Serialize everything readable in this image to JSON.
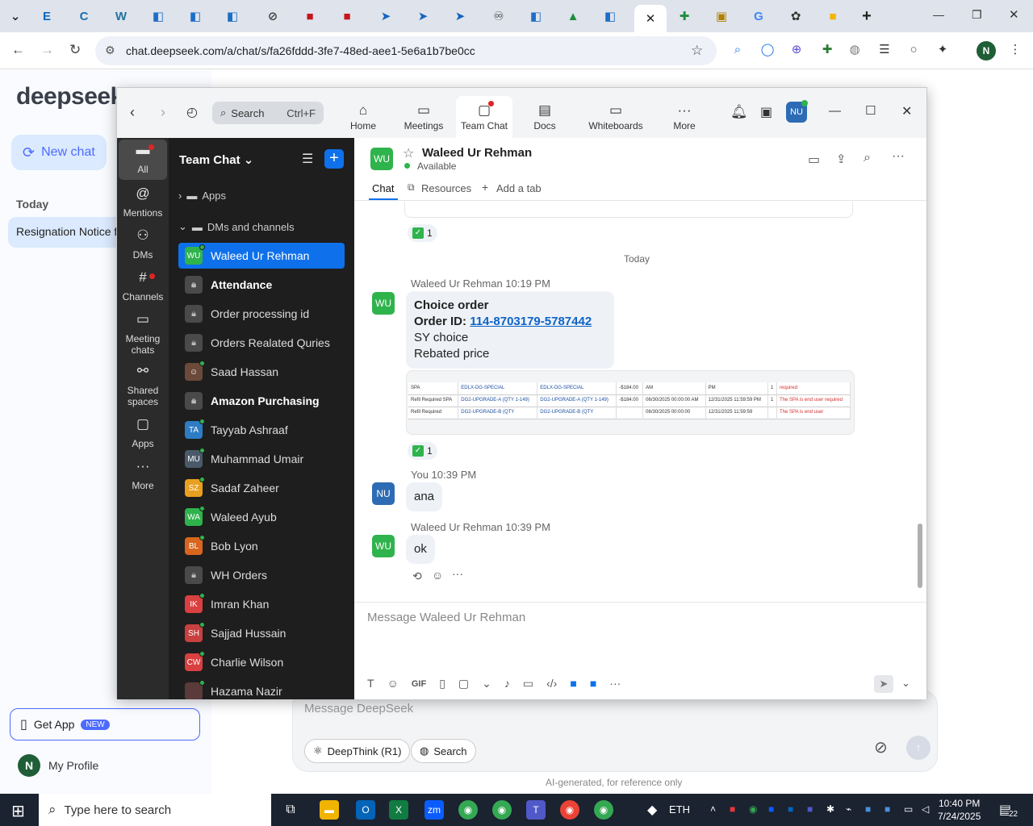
{
  "browser": {
    "url": "chat.deepseek.com/a/chat/s/fa26fddd-3fe7-48ed-aee1-5e6a1b7be0cc",
    "close_tab": "✕",
    "new_tab": "+",
    "profile_initial": "N"
  },
  "deepseek": {
    "logo": "deepseek",
    "new_chat": "New chat",
    "today": "Today",
    "history_item": "Resignation Notice f",
    "get_app": "Get App",
    "get_app_badge": "NEW",
    "profile": "My Profile",
    "profile_initial": "N",
    "input_placeholder": "Message DeepSeek",
    "deepthink": "DeepThink (R1)",
    "search": "Search",
    "ai_note": "AI-generated, for reference only"
  },
  "zoom": {
    "search_label": "Search",
    "search_shortcut": "Ctrl+F",
    "tabs": [
      {
        "label": "Home",
        "icon": "home-icon"
      },
      {
        "label": "Meetings",
        "icon": "video-icon"
      },
      {
        "label": "Team Chat",
        "icon": "chat-icon"
      },
      {
        "label": "Docs",
        "icon": "doc-icon"
      },
      {
        "label": "Whiteboards",
        "icon": "whiteboard-icon"
      },
      {
        "label": "More",
        "icon": "more-icon"
      }
    ],
    "user_initials": "NU",
    "left_nav": [
      {
        "label": "All"
      },
      {
        "label": "Mentions"
      },
      {
        "label": "DMs"
      },
      {
        "label": "Channels"
      },
      {
        "label": "Meeting chats"
      },
      {
        "label": "Shared spaces"
      },
      {
        "label": "Apps"
      },
      {
        "label": "More"
      }
    ],
    "list_title": "Team Chat",
    "group_apps": "Apps",
    "group_dms": "DMs and channels",
    "contacts": [
      {
        "name": "Waleed Ur Rehman",
        "initials": "WU",
        "color": "#2fb34c",
        "type": "dm",
        "selected": true
      },
      {
        "name": "Attendance",
        "initials": "",
        "color": "#4a4a4a",
        "type": "channel",
        "bold": true
      },
      {
        "name": "Order processing id",
        "initials": "",
        "color": "#4a4a4a",
        "type": "channel"
      },
      {
        "name": "Orders Realated Quries",
        "initials": "",
        "color": "#4a4a4a",
        "type": "channel"
      },
      {
        "name": "Saad Hassan",
        "initials": "",
        "color": "#6b4a3a",
        "type": "photo"
      },
      {
        "name": "Amazon Purchasing",
        "initials": "",
        "color": "#4a4a4a",
        "type": "channel",
        "bold": true
      },
      {
        "name": "Tayyab Ashraaf",
        "initials": "TA",
        "color": "#2d7cc4",
        "type": "dm"
      },
      {
        "name": "Muhammad Umair",
        "initials": "MU",
        "color": "#4a5a6a",
        "type": "dm"
      },
      {
        "name": "Sadaf Zaheer",
        "initials": "SZ",
        "color": "#e8a020",
        "type": "dm"
      },
      {
        "name": "Waleed Ayub",
        "initials": "WA",
        "color": "#2fb34c",
        "type": "dm"
      },
      {
        "name": "Bob Lyon",
        "initials": "BL",
        "color": "#d9661e",
        "type": "dm"
      },
      {
        "name": "WH Orders",
        "initials": "",
        "color": "#4a4a4a",
        "type": "channel"
      },
      {
        "name": "Imran Khan",
        "initials": "IK",
        "color": "#d94040",
        "type": "dm"
      },
      {
        "name": "Sajjad Hussain",
        "initials": "SH",
        "color": "#c94040",
        "type": "dm"
      },
      {
        "name": "Charlie Wilson",
        "initials": "CW",
        "color": "#d94040",
        "type": "dm"
      },
      {
        "name": "Hazama Nazir",
        "initials": "",
        "color": "#5a3a3a",
        "type": "dm"
      }
    ],
    "chat": {
      "contact_name": "Waleed Ur Rehman",
      "contact_initials": "WU",
      "status": "Available",
      "tab_chat": "Chat",
      "tab_resources": "Resources",
      "tab_add": "Add a tab",
      "reaction_count": "1",
      "day_divider": "Today",
      "msg1_header": "Waleed Ur Rehman 10:19 PM",
      "msg1_title": "Choice order",
      "msg1_order_label": "Order ID: ",
      "msg1_order_id": "114-8703179-5787442",
      "msg1_line3": "SY choice",
      "msg1_line4": "Rebated price",
      "msg2_header": "You 10:39 PM",
      "msg2_initials": "NU",
      "msg2_text": "ana",
      "msg3_header": "Waleed Ur Rehman 10:39 PM",
      "msg3_text": "ok",
      "compose_placeholder": "Message Waleed Ur Rehman",
      "gif": "GIF"
    },
    "screenshot_rows": [
      [
        "SPA",
        "EDLX-DG-SPECIAL",
        "EDLX-DG-SPECIAL",
        "-$184.00",
        "AM",
        "PM",
        "1",
        "required"
      ],
      [
        "Refil Required SPA",
        "DG2-UPGRADE-A (QTY 1-149)",
        "DG2-UPGRADE-A (QTY 1-149)",
        "-$184.00",
        "06/30/2025 00:00:00 AM",
        "12/31/2025 11:59:59 PM",
        "1",
        "The SPA is end user required"
      ],
      [
        "Refil Required",
        "DG2-UPGRADE-B (QTY",
        "DG2-UPGRADE-B (QTY",
        "",
        "06/30/2025 00:00:00",
        "12/31/2025 11:59:59",
        "",
        "The SPA is end user"
      ]
    ]
  },
  "taskbar": {
    "search_placeholder": "Type here to search",
    "eth": "ETH",
    "time": "10:40 PM",
    "date": "7/24/2025",
    "notif_count": "22"
  }
}
